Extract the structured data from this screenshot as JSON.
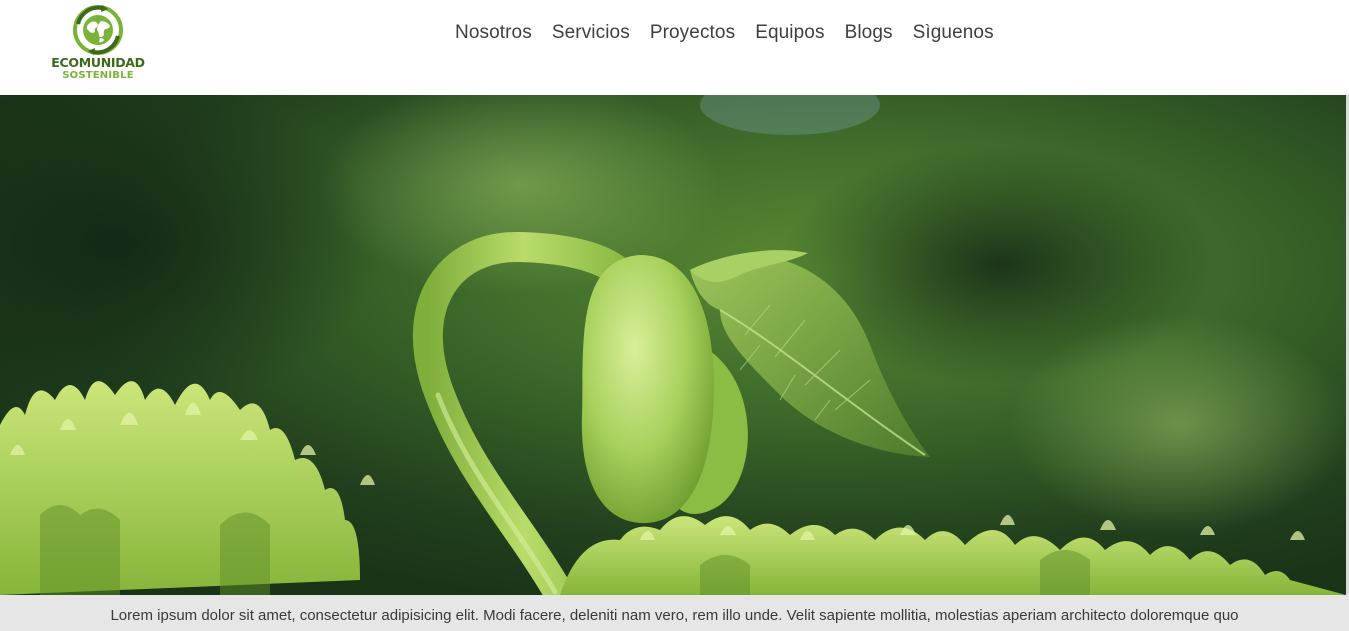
{
  "header": {
    "logo": {
      "icon": "globe-recycle-icon",
      "line1": "ECOMUNIDAD",
      "line2": "SOSTENIBLE",
      "colors": {
        "dark": "#3c6a1a",
        "light": "#79b33a"
      }
    },
    "nav": [
      {
        "label": "Nosotros"
      },
      {
        "label": "Servicios"
      },
      {
        "label": "Proyectos"
      },
      {
        "label": "Equipos"
      },
      {
        "label": "Blogs"
      },
      {
        "label": "Sìguenos"
      }
    ]
  },
  "hero": {
    "image": "sprouting-seedling-photo",
    "colors": {
      "background": "#2c4f23",
      "sprout": "#a9d15a",
      "moss": "#b8dc5a"
    }
  },
  "caption": {
    "text": "Lorem ipsum dolor sit amet, consectetur adipisicing elit. Modi facere, deleniti nam vero, rem illo unde. Velit sapiente mollitia, molestias aperiam architecto doloremque quo"
  }
}
